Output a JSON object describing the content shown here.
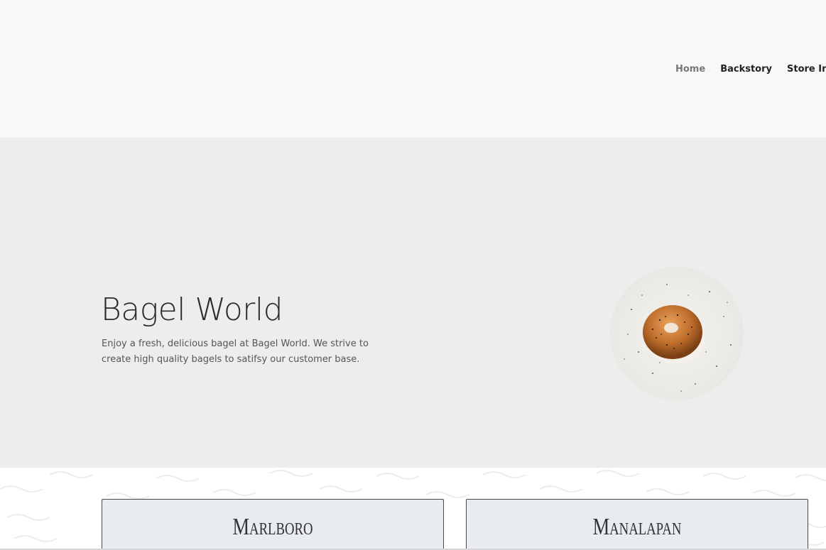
{
  "header": {
    "nav": [
      {
        "label": "Home",
        "active": true
      },
      {
        "label": "Backstory",
        "active": false
      },
      {
        "label": "Store Info",
        "active": false
      }
    ]
  },
  "hero": {
    "title": "Bagel World",
    "description": "Enjoy a fresh, delicious bagel at Bagel World. We strive to create high quality bagels to satifsy our customer base.",
    "image": "bagel-photo"
  },
  "locations": [
    {
      "name": "Marlboro"
    },
    {
      "name": "Manalapan"
    }
  ],
  "colors": {
    "header_bg": "#f7f8fa",
    "hero_bg": "#ededed",
    "card_bg": "#e8ebef",
    "nav_active": "#777777",
    "nav_text": "#222222"
  }
}
